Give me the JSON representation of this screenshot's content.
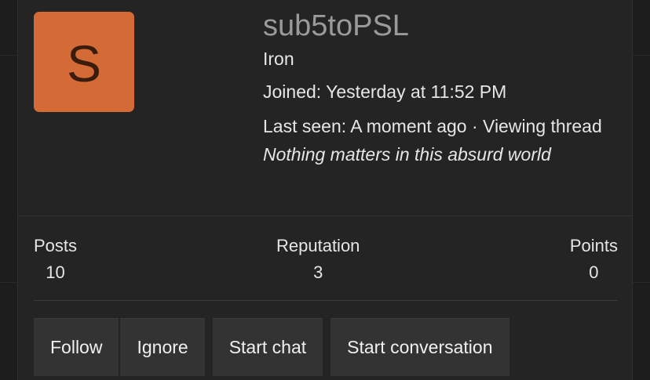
{
  "profile": {
    "avatar_letter": "S",
    "username": "sub5toPSL",
    "user_title": "Iron",
    "joined_label": "Joined:",
    "joined_value": "Yesterday at 11:52 PM",
    "last_seen_label": "Last seen:",
    "last_seen_value": "A moment ago · Viewing thread",
    "last_seen_thread": "Nothing matters in this absurd world"
  },
  "stats": {
    "posts_label": "Posts",
    "posts_value": "10",
    "reputation_label": "Reputation",
    "reputation_value": "3",
    "points_label": "Points",
    "points_value": "0"
  },
  "actions": {
    "follow_label": "Follow",
    "ignore_label": "Ignore",
    "start_chat_label": "Start chat",
    "start_conversation_label": "Start conversation"
  },
  "colors": {
    "avatar_bg": "#d46a35",
    "card_bg": "#242424",
    "button_bg": "#333333",
    "username_color": "#9a9a9a"
  }
}
